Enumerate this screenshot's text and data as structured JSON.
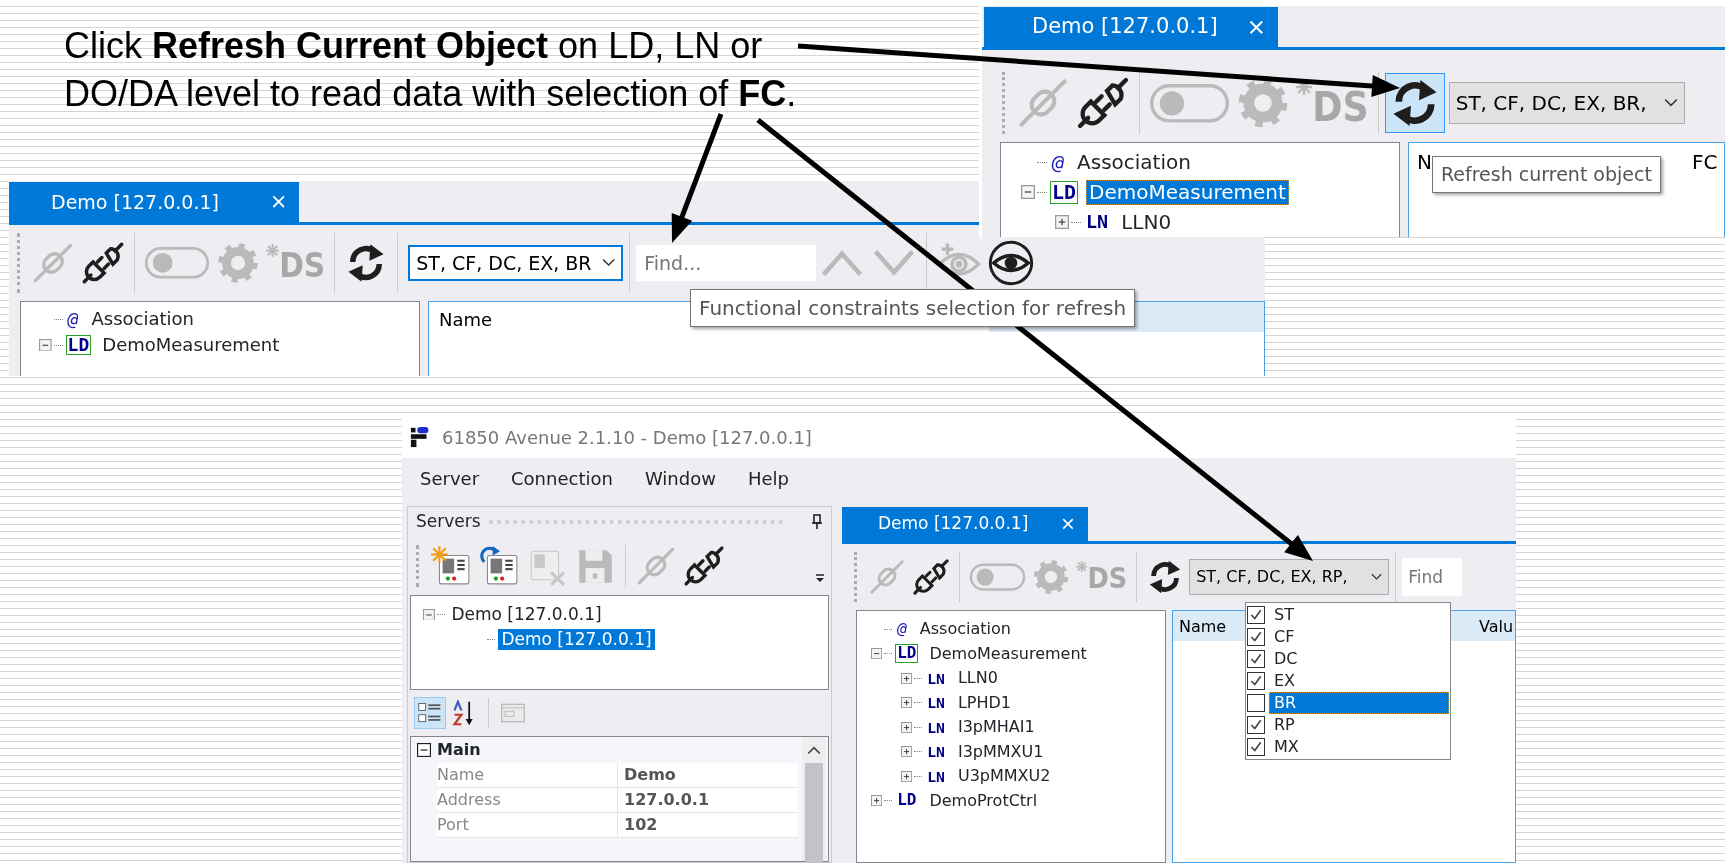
{
  "instruction": [
    "Click **Refresh Current Object** on LD, LN or",
    "DO/DA level to read data with selection of **FC**."
  ],
  "zoom_top": {
    "tab": {
      "label": "Demo [127.0.0.1]",
      "selected": true
    },
    "toolbar": [
      {
        "kind": "connect",
        "disabled": true
      },
      {
        "kind": "disconnect",
        "disabled": false
      },
      {
        "kind": "toggle",
        "disabled": true
      },
      {
        "kind": "settings",
        "disabled": true
      },
      {
        "kind": "dataset",
        "label": "DS",
        "disabled": true
      },
      {
        "kind": "refresh",
        "disabled": false,
        "hovered": true
      }
    ],
    "fc_combo": {
      "value": "ST, CF, DC, EX, BR,",
      "focused": false
    },
    "tree": [
      {
        "kind": "association",
        "badge": "@",
        "label": "Association"
      },
      {
        "kind": "ld",
        "badge": "LD",
        "label": "DemoMeasurement",
        "boxed": true,
        "expanded": true,
        "selected": true,
        "children": [
          {
            "kind": "ln",
            "badge": "LN",
            "label": "LLN0",
            "expanded": false,
            "selected": false
          }
        ]
      }
    ],
    "columns": [
      "N",
      "FC"
    ],
    "tooltip": "Refresh current object"
  },
  "zoom_middle": {
    "tab": {
      "label": "Demo [127.0.0.1]",
      "selected": true
    },
    "toolbar": [
      {
        "kind": "connect",
        "disabled": true
      },
      {
        "kind": "disconnect",
        "disabled": false
      },
      {
        "kind": "toggle",
        "disabled": true
      },
      {
        "kind": "settings",
        "disabled": true
      },
      {
        "kind": "dataset",
        "label": "DS",
        "disabled": true
      },
      {
        "kind": "refresh",
        "disabled": false,
        "hovered": false
      }
    ],
    "fc_combo": {
      "value": "ST, CF, DC, EX, BR",
      "focused": true
    },
    "find": {
      "placeholder": "Find..."
    },
    "nav_buttons": [
      {
        "kind": "up",
        "disabled": true
      },
      {
        "kind": "down",
        "disabled": true
      },
      {
        "kind": "watch_add",
        "disabled": true
      },
      {
        "kind": "watch",
        "disabled": false
      }
    ],
    "tree": [
      {
        "kind": "association",
        "badge": "@",
        "label": "Association"
      },
      {
        "kind": "ld",
        "badge": "LD",
        "label": "DemoMeasurement",
        "boxed": true,
        "expanded": true,
        "selected": false
      }
    ],
    "columns": [
      "Name"
    ],
    "tooltip": "Functional constraints selection for refresh"
  },
  "app": {
    "title": "61850 Avenue 2.1.10 - Demo [127.0.0.1]",
    "menu": [
      "Server",
      "Connection",
      "Window",
      "Help"
    ],
    "servers": {
      "title": "Servers",
      "toolbar": [
        {
          "kind": "add_server",
          "disabled": false
        },
        {
          "kind": "reconnect",
          "disabled": false
        },
        {
          "kind": "remove",
          "disabled": true
        },
        {
          "kind": "save",
          "disabled": true
        },
        {
          "kind": "connect",
          "disabled": true
        },
        {
          "kind": "disconnect",
          "disabled": false
        }
      ],
      "tree": [
        {
          "label": "Demo [127.0.0.1]",
          "expanded": true,
          "selected": false,
          "children": [
            {
              "label": "Demo [127.0.0.1]",
              "selected": true
            }
          ]
        }
      ],
      "property_tools": [
        {
          "kind": "categorized",
          "selected": true,
          "disabled": false
        },
        {
          "kind": "alphabetical",
          "selected": false,
          "disabled": false
        },
        {
          "kind": "property_pages",
          "selected": false,
          "disabled": true
        }
      ],
      "properties": {
        "category": "Main",
        "expanded": true,
        "rows": [
          {
            "name": "Name",
            "value": "Demo"
          },
          {
            "name": "Address",
            "value": "127.0.0.1"
          },
          {
            "name": "Port",
            "value": "102"
          }
        ]
      }
    },
    "document": {
      "tab": {
        "label": "Demo [127.0.0.1]",
        "selected": true
      },
      "toolbar": [
        {
          "kind": "connect",
          "disabled": true
        },
        {
          "kind": "disconnect",
          "disabled": false
        },
        {
          "kind": "toggle",
          "disabled": true
        },
        {
          "kind": "settings",
          "disabled": true
        },
        {
          "kind": "dataset",
          "label": "DS",
          "disabled": true
        },
        {
          "kind": "refresh",
          "disabled": false,
          "hovered": false
        }
      ],
      "fc_combo": {
        "value": "ST, CF, DC, EX, RP,",
        "focused": false
      },
      "find": {
        "placeholder": "Find"
      },
      "tree": [
        {
          "kind": "association",
          "badge": "@",
          "label": "Association"
        },
        {
          "kind": "ld",
          "badge": "LD",
          "label": "DemoMeasurement",
          "boxed": true,
          "expanded": true,
          "selected": false,
          "children": [
            {
              "kind": "ln",
              "badge": "LN",
              "label": "LLN0",
              "expanded": false,
              "selected": false
            },
            {
              "kind": "ln",
              "badge": "LN",
              "label": "LPHD1",
              "expanded": false,
              "selected": false
            },
            {
              "kind": "ln",
              "badge": "LN",
              "label": "I3pMHAI1",
              "expanded": false,
              "selected": false
            },
            {
              "kind": "ln",
              "badge": "LN",
              "label": "I3pMMXU1",
              "expanded": false,
              "selected": false
            },
            {
              "kind": "ln",
              "badge": "LN",
              "label": "U3pMMXU2",
              "expanded": false,
              "selected": false
            }
          ]
        },
        {
          "kind": "ld",
          "badge": "LD",
          "label": "DemoProtCtrl",
          "boxed": false,
          "expanded": false,
          "selected": false
        }
      ],
      "columns": [
        "Name",
        "Valu"
      ],
      "fc_options": [
        {
          "label": "ST",
          "checked": true,
          "selected": false
        },
        {
          "label": "CF",
          "checked": true,
          "selected": false
        },
        {
          "label": "DC",
          "checked": true,
          "selected": false
        },
        {
          "label": "EX",
          "checked": true,
          "selected": false
        },
        {
          "label": "BR",
          "checked": false,
          "selected": true
        },
        {
          "label": "RP",
          "checked": true,
          "selected": false
        },
        {
          "label": "MX",
          "checked": true,
          "selected": false
        }
      ]
    }
  }
}
